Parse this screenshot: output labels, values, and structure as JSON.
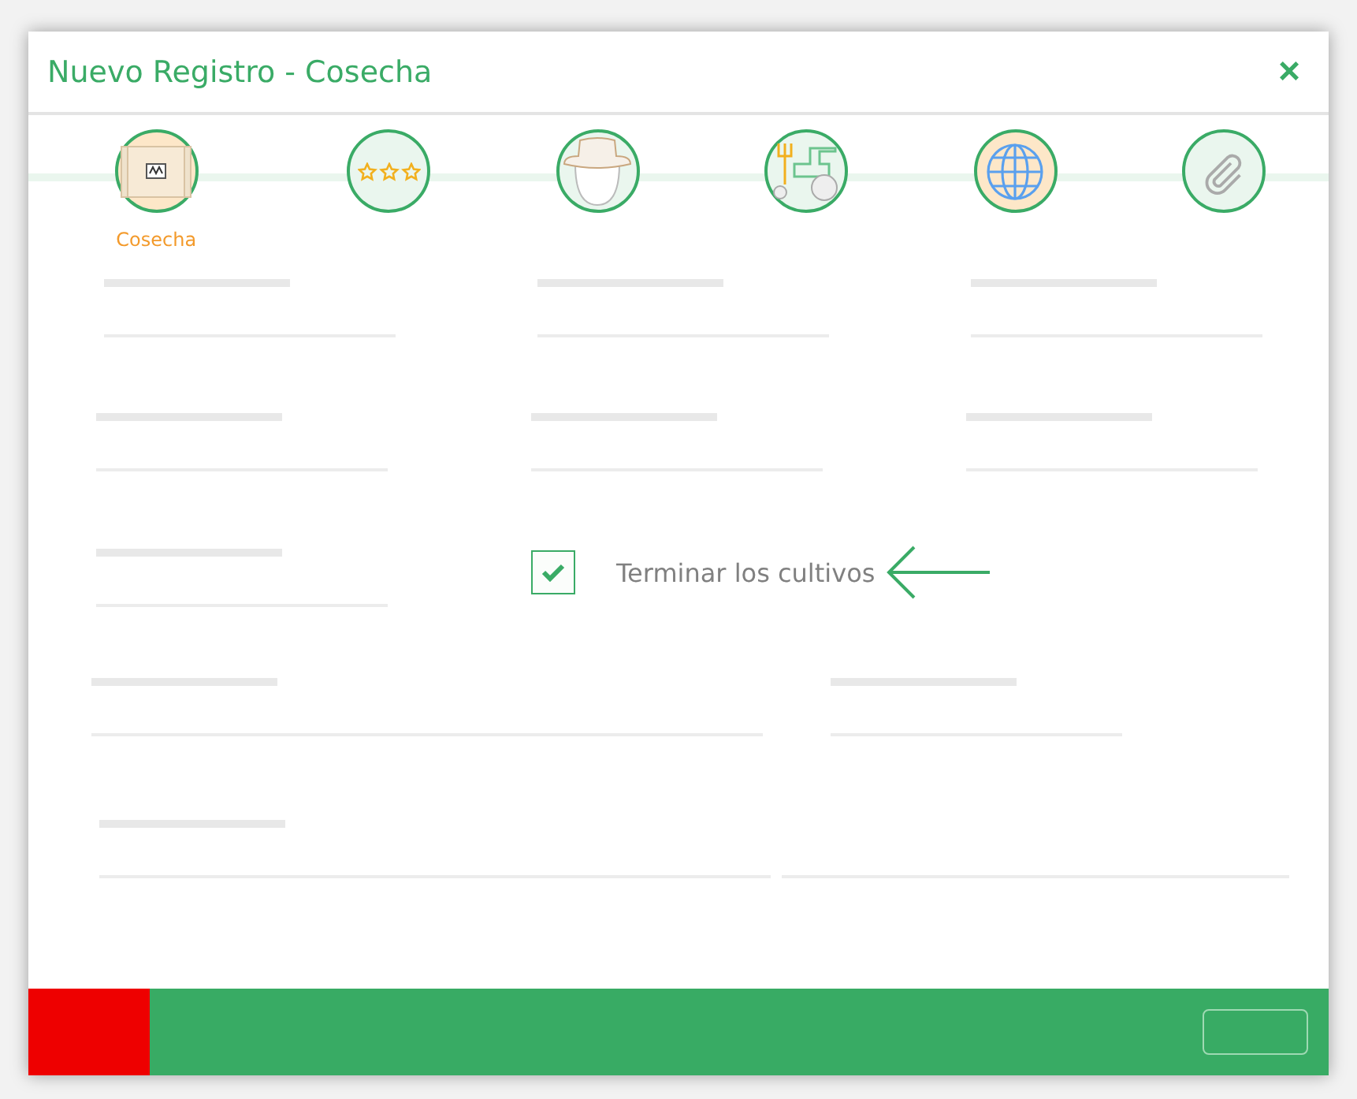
{
  "window": {
    "title": "Nuevo Registro - Cosecha",
    "close": "×"
  },
  "steps": [
    {
      "kind": "crate",
      "label": "Cosecha",
      "highlighted": true
    },
    {
      "kind": "stars",
      "highlighted": false
    },
    {
      "kind": "hat",
      "highlighted": false
    },
    {
      "kind": "tractor",
      "highlighted": false
    },
    {
      "kind": "globe",
      "highlighted": true
    },
    {
      "kind": "clip",
      "highlighted": false
    }
  ],
  "form_rows": [
    {
      "fields": [
        {
          "kind": "field"
        },
        {
          "kind": "field"
        },
        {
          "kind": "field"
        }
      ]
    },
    {
      "fields": [
        {
          "kind": "field"
        },
        {
          "kind": "field"
        },
        {
          "kind": "field"
        }
      ]
    },
    {
      "fields": [
        {
          "kind": "field"
        },
        {
          "kind": "checkbox",
          "label": "Terminar los cultivos",
          "checked": true
        }
      ]
    },
    {
      "fields": [
        {
          "kind": "wide"
        },
        {
          "kind": "field"
        }
      ]
    },
    {
      "fields": [
        {
          "kind": "wide"
        },
        {
          "kind": "line"
        }
      ]
    }
  ]
}
